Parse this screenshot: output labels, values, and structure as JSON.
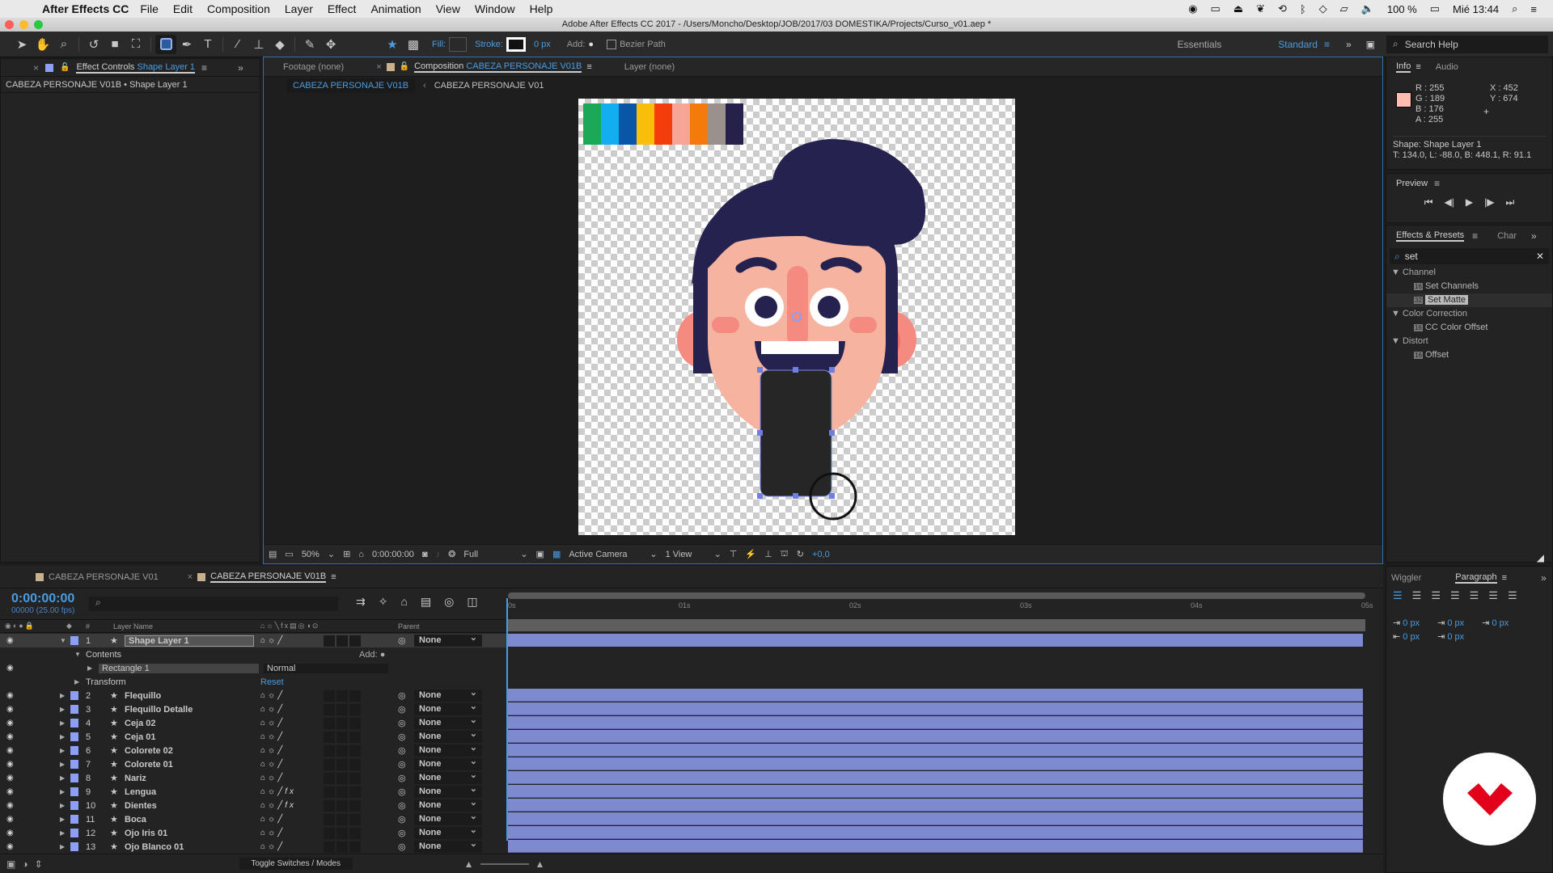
{
  "menubar": {
    "app": "After Effects CC",
    "items": [
      "File",
      "Edit",
      "Composition",
      "Layer",
      "Effect",
      "Animation",
      "View",
      "Window",
      "Help"
    ],
    "battery": "100 %",
    "clock": "Mié 13:44"
  },
  "window": {
    "title": "Adobe After Effects CC 2017 - /Users/Moncho/Desktop/JOB/2017/03 DOMESTIKA/Projects/Curso_v01.aep *"
  },
  "toolbar": {
    "fill_label": "Fill:",
    "stroke_label": "Stroke:",
    "stroke_width": "0 px",
    "add_label": "Add:",
    "bezier_label": "Bezier Path",
    "workspace_essentials": "Essentials",
    "workspace_standard": "Standard",
    "search_placeholder": "Search Help"
  },
  "effect_controls": {
    "tab_prefix": "Effect Controls",
    "tab_layer": "Shape Layer 1",
    "breadcrumb": "CABEZA PERSONAJE V01B • Shape Layer 1"
  },
  "comp_panel": {
    "tab_footage": "Footage (none)",
    "tab_comp_prefix": "Composition",
    "tab_comp_name": "CABEZA PERSONAJE V01B",
    "tab_layer": "Layer (none)",
    "sub_active": "CABEZA PERSONAJE V01B",
    "sub_other": "CABEZA PERSONAJE V01",
    "footer": {
      "zoom": "50%",
      "timecode": "0:00:00:00",
      "resolution": "Full",
      "camera": "Active Camera",
      "views": "1 View",
      "exposure": "+0,0"
    },
    "palette": [
      "#1ba858",
      "#13aef0",
      "#0a56a6",
      "#f9be09",
      "#f43c0c",
      "#f7a596",
      "#f37a0b",
      "#9a918c",
      "#25214a"
    ]
  },
  "info": {
    "tab": "Info",
    "tab2": "Audio",
    "swatch_color": "#ffbdb0",
    "r": "R : 255",
    "g": "G : 189",
    "b": "B : 176",
    "a": "A : 255",
    "x": "X : 452",
    "y": "Y : 674",
    "shape": "Shape: Shape Layer 1",
    "bounds": "T: 134.0, L: -88.0, B: 448.1, R: 91.1"
  },
  "preview": {
    "title": "Preview"
  },
  "effects": {
    "tab": "Effects & Presets",
    "tab2": "Char",
    "search": "set",
    "groups": [
      {
        "name": "Channel",
        "items": [
          "Set Channels",
          "Set Matte"
        ]
      },
      {
        "name": "Color Correction",
        "items": [
          "CC Color Offset"
        ]
      },
      {
        "name": "Distort",
        "items": [
          "Offset"
        ]
      }
    ],
    "selected": "Set Matte"
  },
  "paragraph": {
    "tab1": "Wiggler",
    "tab2": "Paragraph",
    "indent_left": "0 px",
    "space_before": "0 px",
    "indent_first": "0 px",
    "indent_right": "0 px",
    "space_after": "0 px"
  },
  "timeline": {
    "tabs": [
      "CABEZA PERSONAJE V01",
      "CABEZA PERSONAJE V01B"
    ],
    "timecode": "0:00:00:00",
    "fps": "00000 (25.00 fps)",
    "col_layer_name": "Layer Name",
    "col_parent": "Parent",
    "col_num": "#",
    "ruler": [
      "0s",
      "01s",
      "02s",
      "03s",
      "04s",
      "05s"
    ],
    "layer1": {
      "num": "1",
      "name": "Shape Layer 1",
      "parent": "None"
    },
    "contents": "Contents",
    "add": "Add:",
    "rect": "Rectangle 1",
    "blend": "Normal",
    "transform": "Transform",
    "reset": "Reset",
    "layers": [
      {
        "num": "2",
        "name": "Flequillo",
        "fx": false
      },
      {
        "num": "3",
        "name": "Flequillo Detalle",
        "fx": false
      },
      {
        "num": "4",
        "name": "Ceja 02",
        "fx": false
      },
      {
        "num": "5",
        "name": "Ceja 01",
        "fx": false
      },
      {
        "num": "6",
        "name": "Colorete 02",
        "fx": false
      },
      {
        "num": "7",
        "name": "Colorete 01",
        "fx": false
      },
      {
        "num": "8",
        "name": "Nariz",
        "fx": false
      },
      {
        "num": "9",
        "name": "Lengua",
        "fx": true
      },
      {
        "num": "10",
        "name": "Dientes",
        "fx": true
      },
      {
        "num": "11",
        "name": "Boca",
        "fx": false
      },
      {
        "num": "12",
        "name": "Ojo Iris 01",
        "fx": false
      },
      {
        "num": "13",
        "name": "Ojo Blanco 01",
        "fx": false
      }
    ],
    "parent_value": "None",
    "toggle": "Toggle Switches / Modes"
  }
}
